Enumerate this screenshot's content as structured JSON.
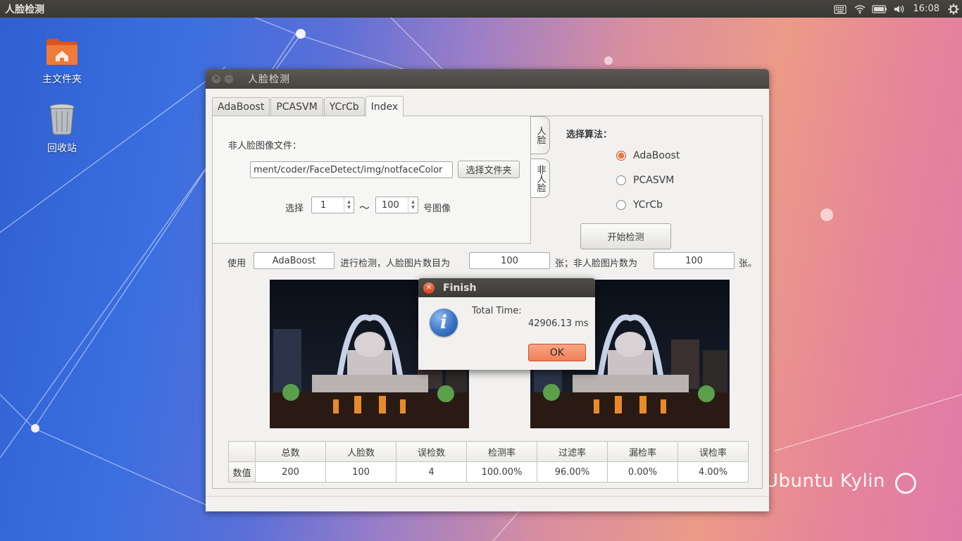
{
  "top_panel": {
    "title": "人脸检测",
    "clock": "16:08"
  },
  "desktop": {
    "icons": [
      {
        "label": "主文件夹",
        "icon": "home-folder-icon"
      },
      {
        "label": "回收站",
        "icon": "trash-icon"
      }
    ],
    "brand": "Ubuntu Kylin"
  },
  "window": {
    "title": "人脸检测",
    "tabs": [
      "AdaBoost",
      "PCASVM",
      "YCrCb",
      "Index"
    ],
    "active_tab": "Index",
    "nonface_label": "非人脸图像文件：",
    "file_path": "ment/coder/FaceDetect/img/notfaceColor",
    "choose_file_button": "选择文件夹",
    "select_label": "选择",
    "range_from": "1",
    "range_sep": "～",
    "range_to": "100",
    "range_suffix": "号图像",
    "side_tabs": [
      "人脸",
      "非人脸"
    ],
    "algo_label": "选择算法：",
    "algorithms": [
      {
        "label": "AdaBoost",
        "checked": true
      },
      {
        "label": "PCASVM",
        "checked": false
      },
      {
        "label": "YCrCb",
        "checked": false
      }
    ],
    "start_button": "开始检测",
    "summary": {
      "use_label": "使用",
      "algo_value": "AdaBoost",
      "mid_label": "进行检测，人脸图片数目为",
      "face_count": "100",
      "mid2_label": "张；非人脸图片数为",
      "nonface_count": "100",
      "end_label": "张。"
    },
    "table": {
      "headers": [
        "",
        "总数",
        "人脸数",
        "误检数",
        "检测率",
        "过滤率",
        "漏检率",
        "误检率"
      ],
      "row_label": "数值",
      "values": [
        "200",
        "100",
        "4",
        "100.00%",
        "96.00%",
        "0.00%",
        "4.00%"
      ]
    }
  },
  "dialog": {
    "title": "Finish",
    "line1": "Total Time:",
    "line2": "42906.13 ms",
    "ok_button": "OK"
  }
}
